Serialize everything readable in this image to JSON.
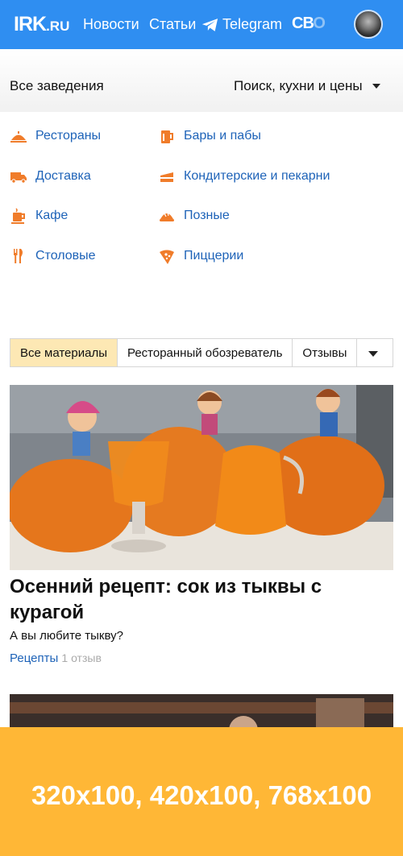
{
  "header": {
    "logo_main": "IRK",
    "logo_suffix": ".RU",
    "nav": [
      {
        "label": "Новости"
      },
      {
        "label": "Статьи"
      },
      {
        "label": "Telegram"
      }
    ],
    "cbo_label": "СВ",
    "cbo_label_o": "О",
    "icons": [
      "telegram-icon",
      "avatar"
    ]
  },
  "filter": {
    "left_label": "Все заведения",
    "right_label": "Поиск, кухни и цены"
  },
  "categories": [
    {
      "label": "Рестораны",
      "icon": "cloche-icon"
    },
    {
      "label": "Бары и пабы",
      "icon": "beer-icon"
    },
    {
      "label": "Доставка",
      "icon": "truck-icon"
    },
    {
      "label": "Кондитерские и пекарни",
      "icon": "cake-icon"
    },
    {
      "label": "Кафе",
      "icon": "coffee-icon"
    },
    {
      "label": "Позные",
      "icon": "dumpling-icon"
    },
    {
      "label": "Столовые",
      "icon": "cutlery-icon"
    },
    {
      "label": "Пиццерии",
      "icon": "pizza-icon"
    }
  ],
  "tabs": [
    {
      "label": "Все материалы",
      "active": true
    },
    {
      "label": "Ресторанный обозреватель",
      "active": false
    },
    {
      "label": "Отзывы",
      "active": false
    }
  ],
  "article": {
    "title": "Осенний рецепт: сок из тыквы с курагой",
    "subtitle": "А вы любите тыкву?",
    "tag": "Рецепты",
    "reviews": "1 отзыв"
  },
  "ad": {
    "text": "320x100, 420x100, 768x100"
  },
  "colors": {
    "header_bg": "#2f8ef1",
    "link": "#1e63b8",
    "icon_orange": "#f07c2a",
    "tab_active": "#fde8b4",
    "ad_bg": "#ffb736"
  }
}
